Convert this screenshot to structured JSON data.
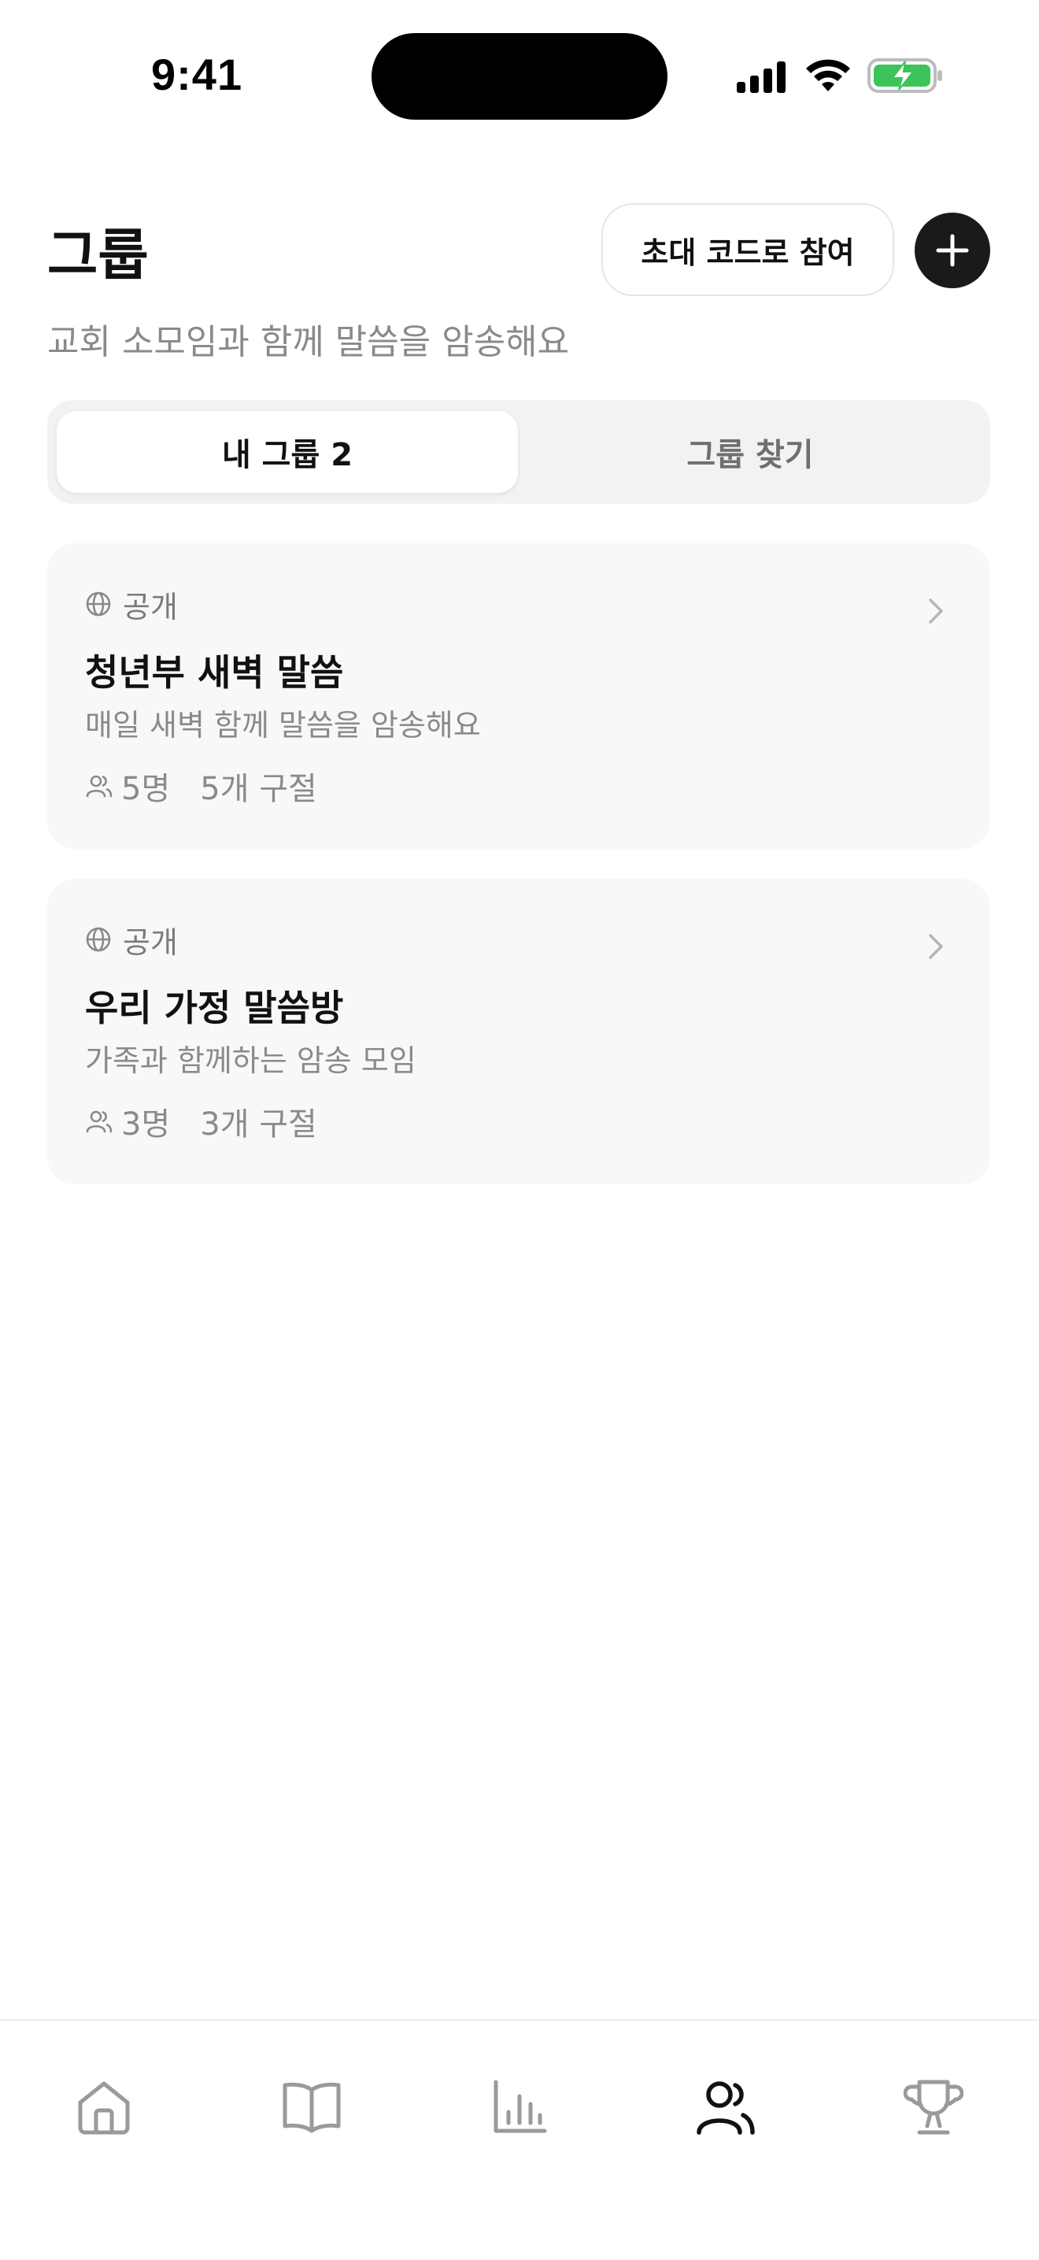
{
  "status_bar": {
    "time": "9:41",
    "icons": [
      "cellular-signal-icon",
      "wifi-icon",
      "battery-charging-icon"
    ],
    "battery_color": "#3cc45a"
  },
  "header": {
    "title": "그룹",
    "subtitle": "교회 소모임과 함께 말씀을 암송해요",
    "invite_button_label": "초대 코드로 참여",
    "add_button_icon": "plus-icon"
  },
  "tabs": [
    {
      "label": "내 그룹 2",
      "active": true
    },
    {
      "label": "그룹 찾기",
      "active": false
    }
  ],
  "groups": [
    {
      "visibility": "공개",
      "name": "청년부 새벽 말씀",
      "description": "매일 새벽 함께 말씀을 암송해요",
      "members": "5명",
      "verses": "5개 구절"
    },
    {
      "visibility": "공개",
      "name": "우리 가정 말씀방",
      "description": "가족과 함께하는 암송 모임",
      "members": "3명",
      "verses": "3개 구절"
    }
  ],
  "bottom_nav": {
    "items": [
      {
        "icon": "home-icon",
        "active": false
      },
      {
        "icon": "book-icon",
        "active": false
      },
      {
        "icon": "chart-icon",
        "active": false
      },
      {
        "icon": "users-icon",
        "active": true
      },
      {
        "icon": "trophy-icon",
        "active": false
      }
    ]
  },
  "colors": {
    "accent": "#1a1a1a",
    "muted_text": "#8a8a8a",
    "card_background": "#f8f8f8"
  }
}
